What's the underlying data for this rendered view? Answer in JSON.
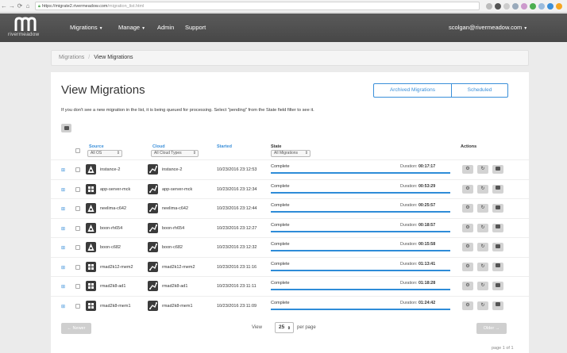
{
  "browser": {
    "url_host": "https://migrate2.rivermeadow.com",
    "url_path": "/migration_list.html"
  },
  "nav": {
    "logo_text": "rivermeadow",
    "items": [
      {
        "label": "Migrations",
        "caret": "▼"
      },
      {
        "label": "Manage",
        "caret": "▼"
      },
      {
        "label": "Admin",
        "caret": ""
      },
      {
        "label": "Support",
        "caret": ""
      }
    ],
    "user": "scolgan@rivermeadow.com",
    "user_caret": "▼"
  },
  "breadcrumb": {
    "parent": "Migrations",
    "separator": "/",
    "current": "View Migrations"
  },
  "page": {
    "title": "View Migrations",
    "tabs": [
      "Archived Migrations",
      "Scheduled"
    ],
    "info": "If you don't see a new migration in the list, it is being queued for processing. Select \"pending\" from the State field filter to see it."
  },
  "table": {
    "headers": {
      "source": "Source",
      "cloud": "Cloud",
      "started": "Started",
      "state": "State",
      "actions": "Actions"
    },
    "filters": {
      "source": "All OS",
      "cloud": "All Cloud Types",
      "state": "All Migrations"
    },
    "duration_label": "Duration:",
    "rows": [
      {
        "os": "linux",
        "source": "instance-2",
        "cloud": "instance-2",
        "started": "10/23/2016 23:12:53",
        "state": "Complete",
        "duration": "00:17:17"
      },
      {
        "os": "windows",
        "source": "app-server-mck",
        "cloud": "app-server-mck",
        "started": "10/23/2016 23:12:34",
        "state": "Complete",
        "duration": "00:53:29"
      },
      {
        "os": "linux",
        "source": "neelima-c642",
        "cloud": "neelima-c642",
        "started": "10/23/2016 23:12:44",
        "state": "Complete",
        "duration": "00:25:57"
      },
      {
        "os": "linux",
        "source": "boon-rh654",
        "cloud": "boon-rh654",
        "started": "10/23/2016 23:12:27",
        "state": "Complete",
        "duration": "00:18:57"
      },
      {
        "os": "linux",
        "source": "boon-c682",
        "cloud": "boon-c682",
        "started": "10/23/2016 23:12:32",
        "state": "Complete",
        "duration": "00:15:58"
      },
      {
        "os": "windows",
        "source": "rmad2k12-mem2",
        "cloud": "rmad2k12-mem2",
        "started": "10/23/2016 23:11:16",
        "state": "Complete",
        "duration": "01:13:41"
      },
      {
        "os": "windows",
        "source": "rmad2k8-ad1",
        "cloud": "rmad2k8-ad1",
        "started": "10/23/2016 23:11:11",
        "state": "Complete",
        "duration": "01:18:28"
      },
      {
        "os": "windows",
        "source": "rmad2k8-mem1",
        "cloud": "rmad2k8-mem1",
        "started": "10/23/2016 23:11:09",
        "state": "Complete",
        "duration": "01:24:42"
      }
    ]
  },
  "footer": {
    "newer": "← Newer",
    "older": "Older →",
    "view_label": "View",
    "per_page": "25",
    "per_page_suffix": "per page",
    "page_info": "page 1 of 1"
  },
  "colors": {
    "accent": "#3a8fd9",
    "nav_bg": "#4f4f4f",
    "progress": "#2e8cd8"
  }
}
